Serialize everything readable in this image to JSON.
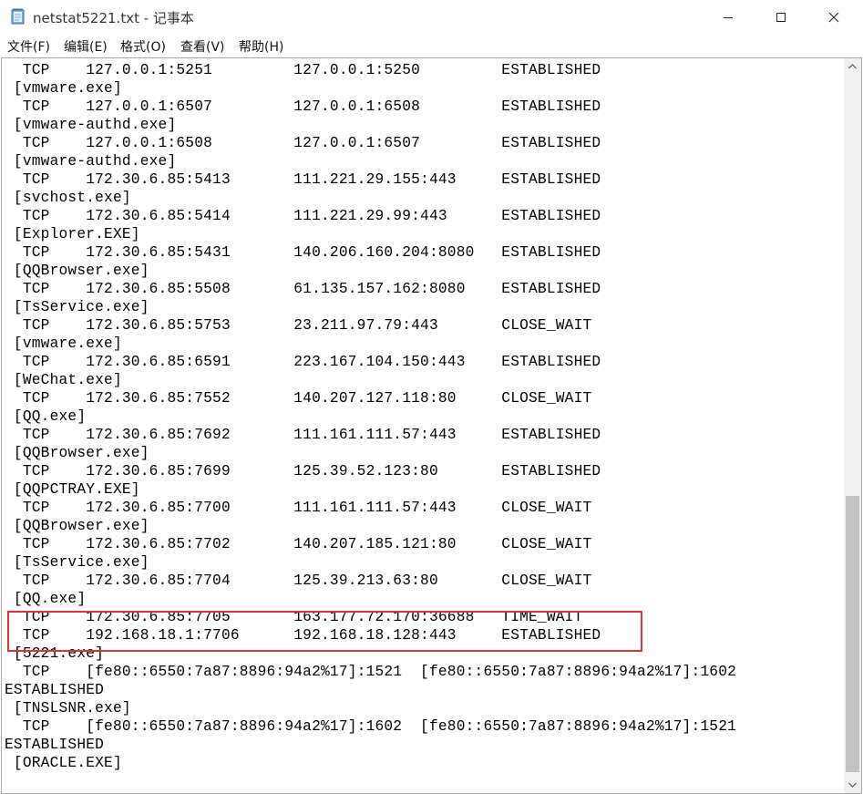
{
  "window": {
    "title": "netstat5221.txt - 记事本"
  },
  "menu": [
    {
      "label": "文件(F)"
    },
    {
      "label": "编辑(E)"
    },
    {
      "label": "格式(O)"
    },
    {
      "label": "查看(V)"
    },
    {
      "label": "帮助(H)"
    }
  ],
  "lines": [
    "  TCP    127.0.0.1:5251         127.0.0.1:5250         ESTABLISHED",
    " [vmware.exe]",
    "  TCP    127.0.0.1:6507         127.0.0.1:6508         ESTABLISHED",
    " [vmware-authd.exe]",
    "  TCP    127.0.0.1:6508         127.0.0.1:6507         ESTABLISHED",
    " [vmware-authd.exe]",
    "  TCP    172.30.6.85:5413       111.221.29.155:443     ESTABLISHED",
    " [svchost.exe]",
    "  TCP    172.30.6.85:5414       111.221.29.99:443      ESTABLISHED",
    " [Explorer.EXE]",
    "  TCP    172.30.6.85:5431       140.206.160.204:8080   ESTABLISHED",
    " [QQBrowser.exe]",
    "  TCP    172.30.6.85:5508       61.135.157.162:8080    ESTABLISHED",
    " [TsService.exe]",
    "  TCP    172.30.6.85:5753       23.211.97.79:443       CLOSE_WAIT",
    " [vmware.exe]",
    "  TCP    172.30.6.85:6591       223.167.104.150:443    ESTABLISHED",
    " [WeChat.exe]",
    "  TCP    172.30.6.85:7552       140.207.127.118:80     CLOSE_WAIT",
    " [QQ.exe]",
    "  TCP    172.30.6.85:7692       111.161.111.57:443     ESTABLISHED",
    " [QQBrowser.exe]",
    "  TCP    172.30.6.85:7699       125.39.52.123:80       ESTABLISHED",
    " [QQPCTRAY.EXE]",
    "  TCP    172.30.6.85:7700       111.161.111.57:443     CLOSE_WAIT",
    " [QQBrowser.exe]",
    "  TCP    172.30.6.85:7702       140.207.185.121:80     CLOSE_WAIT",
    " [TsService.exe]",
    "  TCP    172.30.6.85:7704       125.39.213.63:80       CLOSE_WAIT",
    " [QQ.exe]",
    "  TCP    172.30.6.85:7705       163.177.72.170:36688   TIME_WAIT",
    "  TCP    192.168.18.1:7706      192.168.18.128:443     ESTABLISHED",
    " [5221.exe]",
    "  TCP    [fe80::6550:7a87:8896:94a2%17]:1521  [fe80::6550:7a87:8896:94a2%17]:1602",
    "ESTABLISHED",
    " [TNSLSNR.exe]",
    "  TCP    [fe80::6550:7a87:8896:94a2%17]:1602  [fe80::6550:7a87:8896:94a2%17]:1521",
    "ESTABLISHED",
    " [ORACLE.EXE]"
  ]
}
